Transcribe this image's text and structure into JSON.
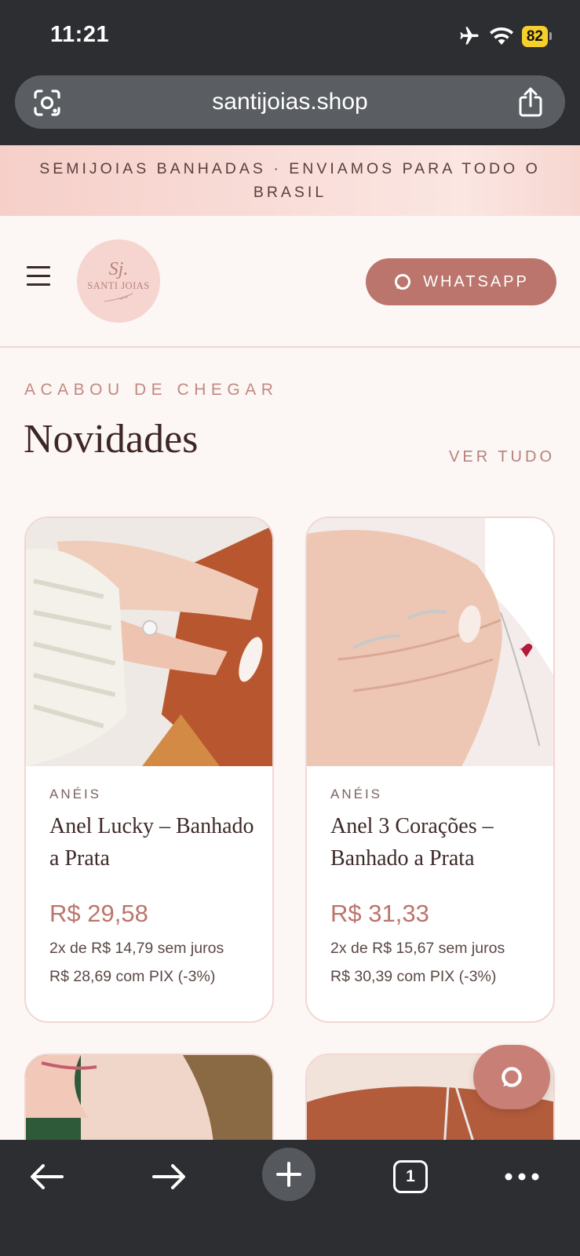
{
  "status_bar": {
    "time": "11:21",
    "battery": "82"
  },
  "browser": {
    "url": "santijoias.shop",
    "tab_count": "1"
  },
  "announcement": "SEMIJOIAS BANHADAS · ENVIAMOS PARA TODO O BRASIL",
  "header": {
    "logo": {
      "monogram": "Sj.",
      "name": "SANTI JOIAS"
    },
    "whatsapp_label": "WHATSAPP"
  },
  "section": {
    "eyebrow": "ACABOU DE CHEGAR",
    "title": "Novidades",
    "see_all": "VER TUDO"
  },
  "products": [
    {
      "category": "ANÉIS",
      "name": "Anel Lucky – Banhado a Prata",
      "price": "R$ 29,58",
      "installments": "2x de R$ 14,79 sem juros",
      "pix": "R$ 28,69 com PIX (-3%)"
    },
    {
      "category": "ANÉIS",
      "name": "Anel 3 Corações – Banhado a Prata",
      "price": "R$ 31,33",
      "installments": "2x de R$ 15,67 sem juros",
      "pix": "R$ 30,39 com PIX (-3%)"
    }
  ],
  "colors": {
    "accent": "#bb756c",
    "banner": "#f6cfc9",
    "background": "#fcf6f4",
    "chrome": "#2c2e31"
  }
}
